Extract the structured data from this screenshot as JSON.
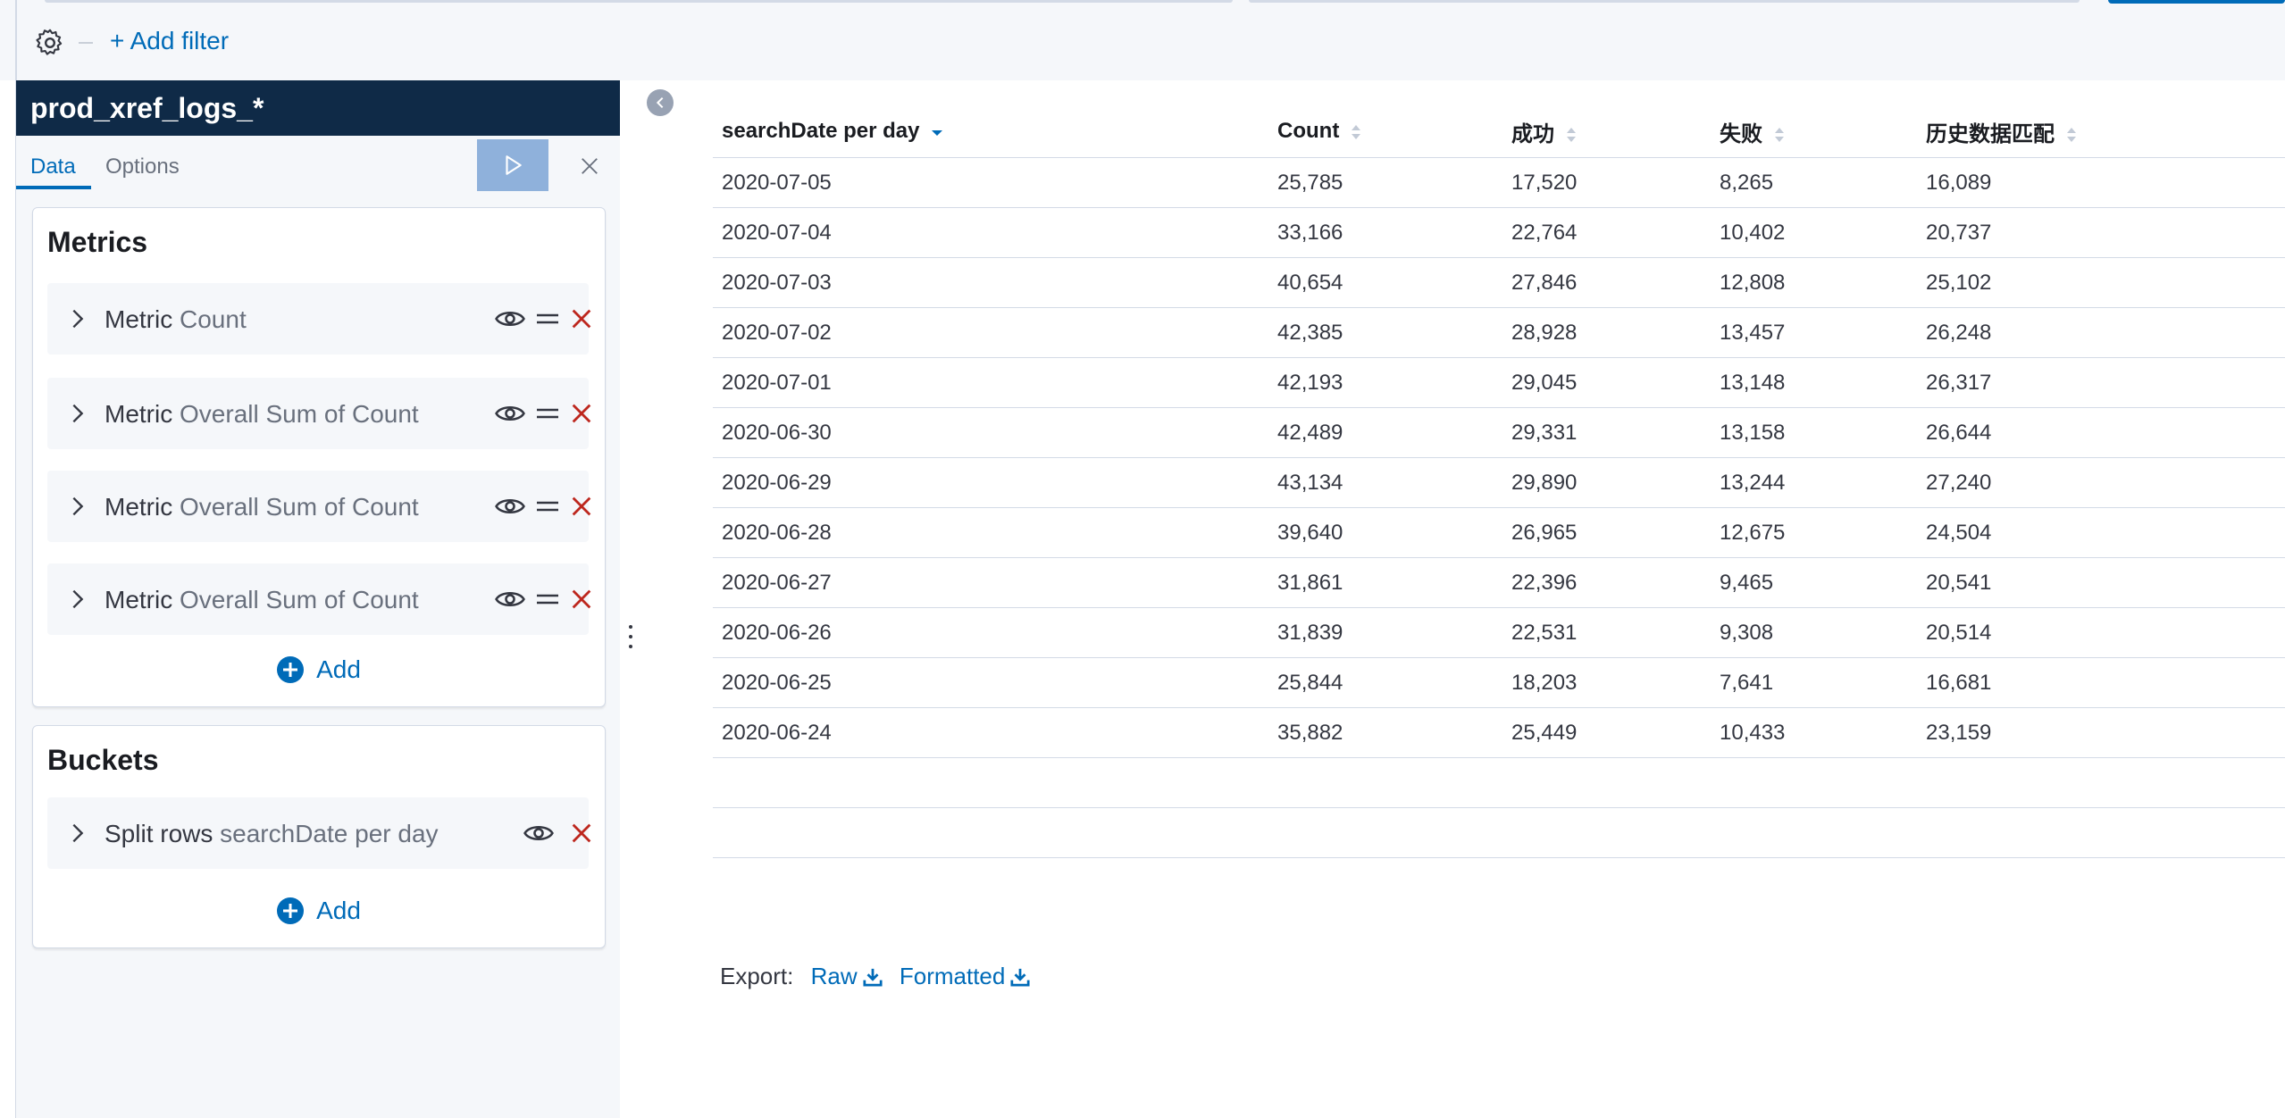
{
  "filters": {
    "add_filter_label": "+ Add filter"
  },
  "index": {
    "title": "prod_xref_logs_*"
  },
  "tabs": {
    "data_label": "Data",
    "options_label": "Options"
  },
  "metrics": {
    "title": "Metrics",
    "items": [
      {
        "type": "Metric",
        "description": "Count"
      },
      {
        "type": "Metric",
        "description": "Overall Sum of Count"
      },
      {
        "type": "Metric",
        "description": "Overall Sum of Count"
      },
      {
        "type": "Metric",
        "description": "Overall Sum of Count"
      }
    ],
    "add_label": "Add"
  },
  "buckets": {
    "title": "Buckets",
    "items": [
      {
        "type": "Split rows",
        "description": "searchDate per day"
      }
    ],
    "add_label": "Add"
  },
  "table": {
    "columns": [
      "searchDate per day",
      "Count",
      "成功",
      "失败",
      "历史数据匹配"
    ],
    "rows": [
      [
        "2020-07-05",
        "25,785",
        "17,520",
        "8,265",
        "16,089"
      ],
      [
        "2020-07-04",
        "33,166",
        "22,764",
        "10,402",
        "20,737"
      ],
      [
        "2020-07-03",
        "40,654",
        "27,846",
        "12,808",
        "25,102"
      ],
      [
        "2020-07-02",
        "42,385",
        "28,928",
        "13,457",
        "26,248"
      ],
      [
        "2020-07-01",
        "42,193",
        "29,045",
        "13,148",
        "26,317"
      ],
      [
        "2020-06-30",
        "42,489",
        "29,331",
        "13,158",
        "26,644"
      ],
      [
        "2020-06-29",
        "43,134",
        "29,890",
        "13,244",
        "27,240"
      ],
      [
        "2020-06-28",
        "39,640",
        "26,965",
        "12,675",
        "24,504"
      ],
      [
        "2020-06-27",
        "31,861",
        "22,396",
        "9,465",
        "20,541"
      ],
      [
        "2020-06-26",
        "31,839",
        "22,531",
        "9,308",
        "20,514"
      ],
      [
        "2020-06-25",
        "25,844",
        "18,203",
        "7,641",
        "16,681"
      ],
      [
        "2020-06-24",
        "35,882",
        "25,449",
        "10,433",
        "23,159"
      ]
    ]
  },
  "export": {
    "label": "Export:",
    "raw_label": "Raw",
    "formatted_label": "Formatted"
  },
  "colors": {
    "link": "#006bb8",
    "header": "#0f2a47",
    "delete": "#bd271e"
  }
}
